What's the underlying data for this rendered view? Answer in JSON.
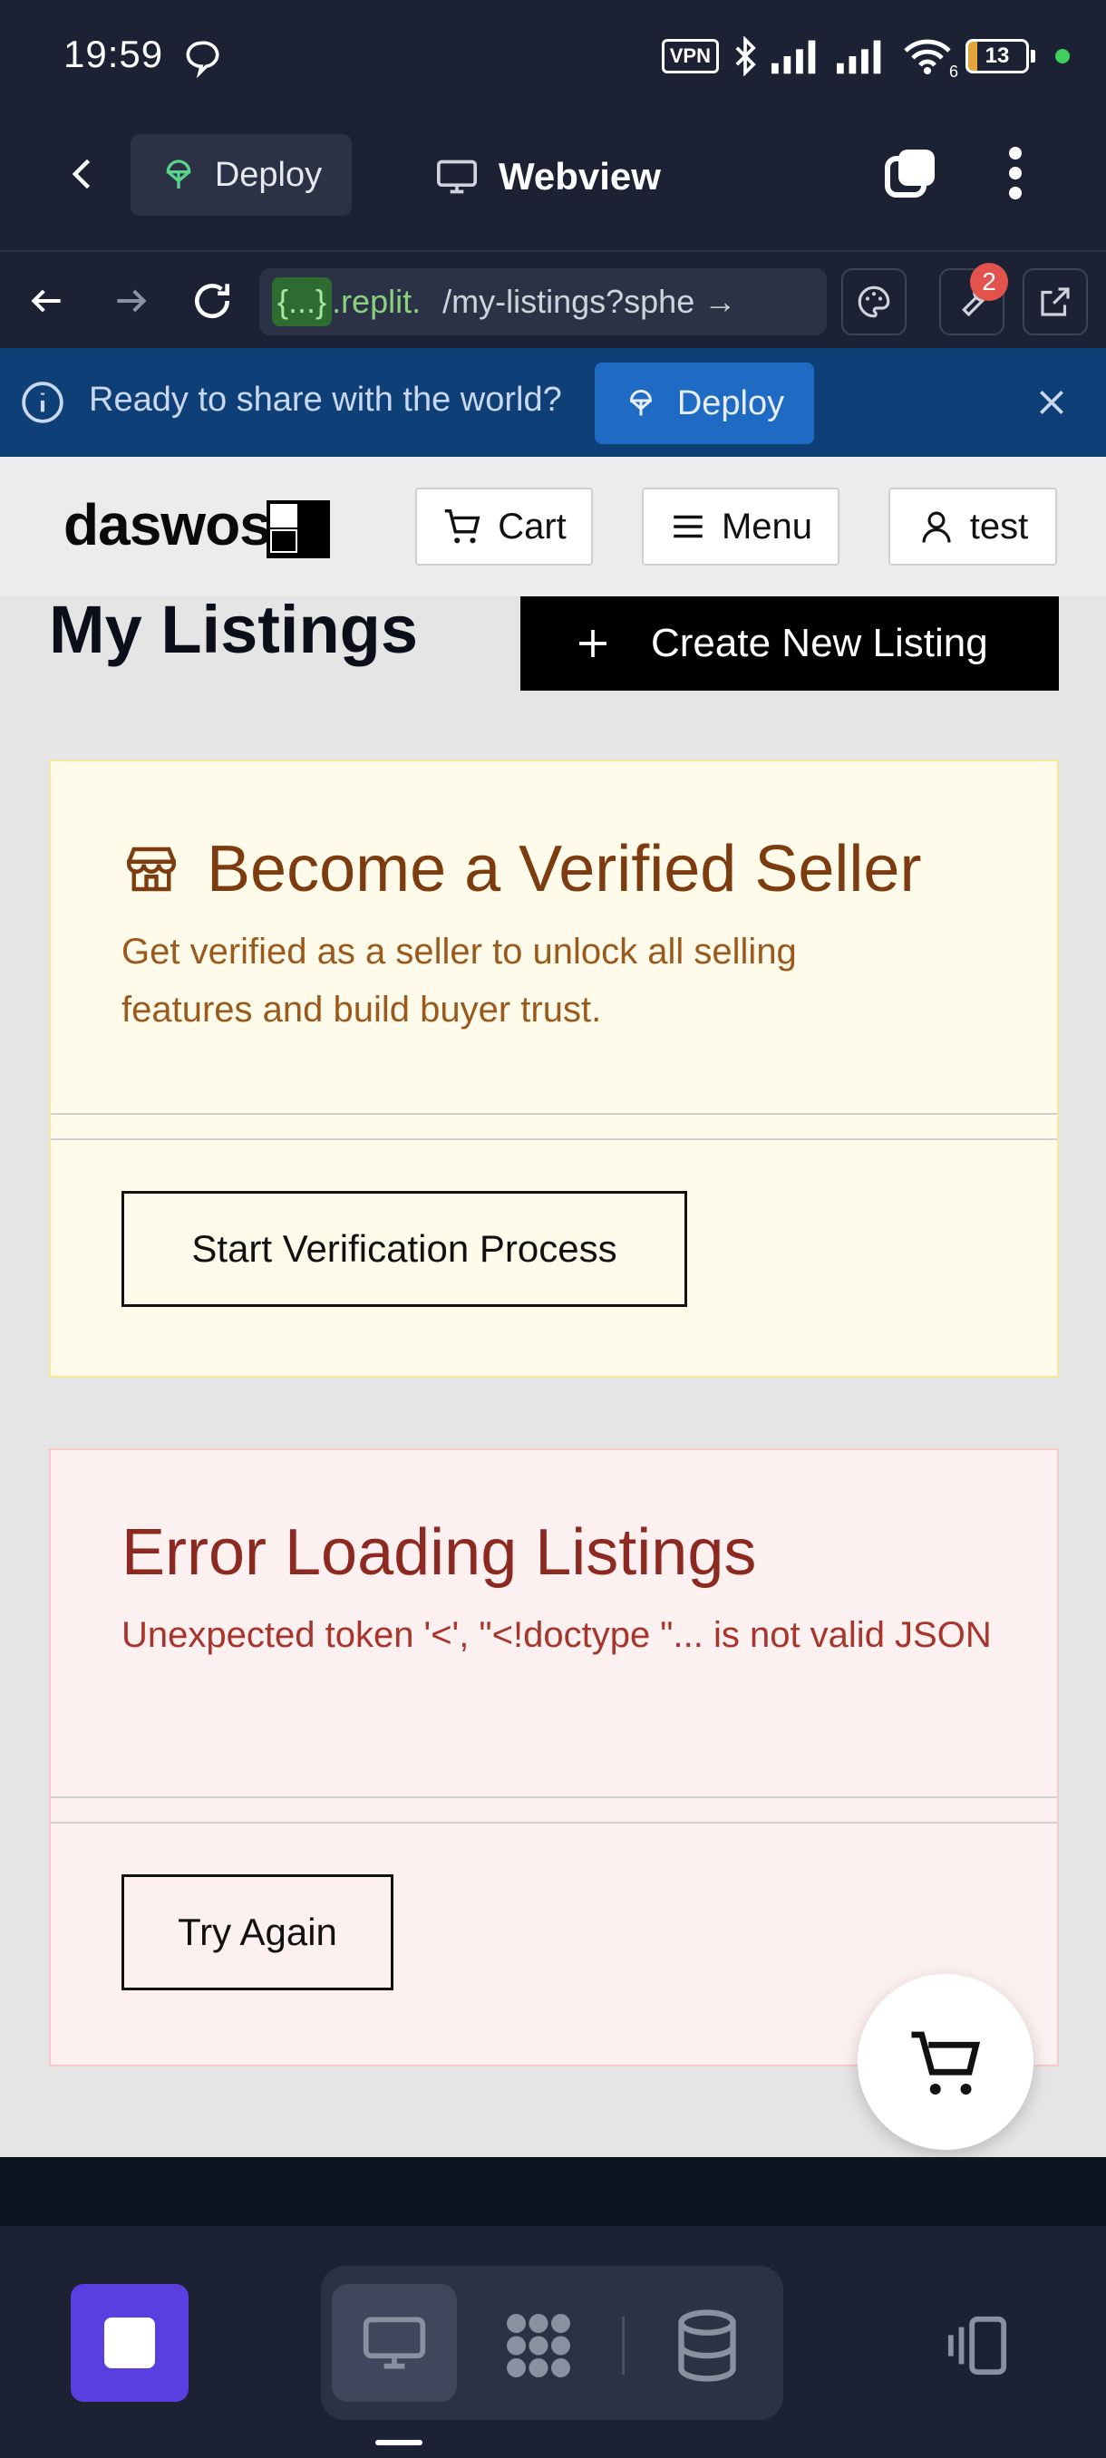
{
  "status_bar": {
    "time": "19:59",
    "vpn_label": "VPN",
    "wifi_gen": "6",
    "battery": "13"
  },
  "header": {
    "deploy_label": "Deploy",
    "webview_label": "Webview"
  },
  "url_bar": {
    "host_chip": "{...}",
    "host_rest": ".replit.",
    "path": "/my-listings?sphe →",
    "badge_count": "2"
  },
  "banner": {
    "text": "Ready to share with the world?",
    "deploy_label": "Deploy"
  },
  "site": {
    "logo": "daswos",
    "nav": {
      "cart_label": "Cart",
      "menu_label": "Menu",
      "user_label": "test"
    },
    "page_title": "My Listings",
    "create_button": "Create New Listing",
    "seller_card": {
      "title": "Become a Verified Seller",
      "description": "Get verified as a seller to unlock all selling features and build buyer trust.",
      "button": "Start Verification Process"
    },
    "error_card": {
      "title": "Error Loading Listings",
      "description": "Unexpected token '<', \"<!doctype \"... is not valid JSON",
      "button": "Try Again"
    }
  },
  "colors": {
    "accent_purple": "#5b3ee0",
    "banner_blue": "#0e3f77",
    "seller_title": "#7c3c0f",
    "error_title": "#8c2a22"
  }
}
